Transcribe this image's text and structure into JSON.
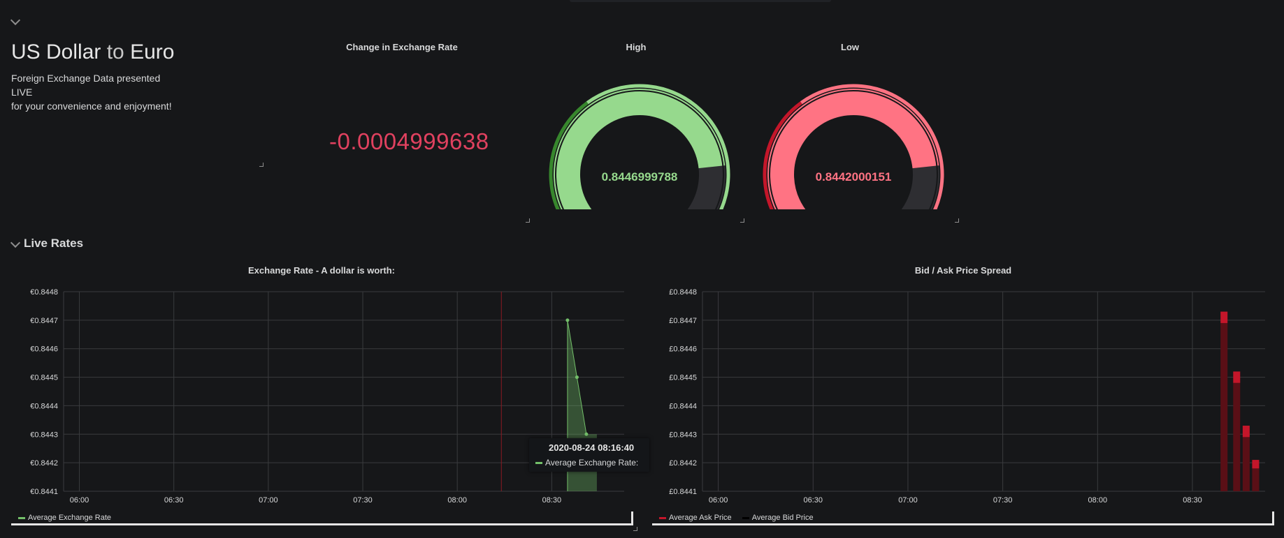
{
  "header": {
    "title_from": "US Dollar",
    "title_to_word": "to",
    "title_to": "Euro",
    "desc_line1": "Foreign Exchange Data presented LIVE",
    "desc_line2": "for your convenience and enjoyment!"
  },
  "stat_panel": {
    "title": "Change in Exchange Rate",
    "value": "-0.0004999638",
    "color": "#e0415f"
  },
  "gauge_high": {
    "title": "High",
    "value": "0.8446999788",
    "fill_fraction": 0.78,
    "color": "#96d98d",
    "dark_color": "#37872d",
    "text_color": "#96d98d"
  },
  "gauge_low": {
    "title": "Low",
    "value": "0.8442000151",
    "fill_fraction": 0.78,
    "color": "#ff7383",
    "dark_color": "#c4162a",
    "text_color": "#ff7383"
  },
  "row": {
    "title": "Live Rates"
  },
  "chart_left": {
    "title": "Exchange Rate - A dollar is worth:",
    "legend": "Average Exchange Rate",
    "tooltip_time": "2020-08-24 08:16:40",
    "tooltip_label": "Average Exchange Rate:"
  },
  "chart_right": {
    "title": "Bid / Ask Price Spread",
    "legend_ask": "Average Ask Price",
    "legend_bid": "Average Bid Price"
  },
  "chart_data": [
    {
      "type": "area",
      "title": "Exchange Rate - A dollar is worth:",
      "x_ticks": [
        "06:00",
        "06:30",
        "07:00",
        "07:30",
        "08:00",
        "08:30"
      ],
      "y_ticks": [
        "€0.8441",
        "€0.8442",
        "€0.8443",
        "€0.8444",
        "€0.8445",
        "€0.8446",
        "€0.8447",
        "€0.8448"
      ],
      "ylim": [
        0.8441,
        0.8448
      ],
      "xlim": [
        "05:55",
        "08:53"
      ],
      "series": [
        {
          "name": "Average Exchange Rate",
          "color": "#73bf69",
          "points": [
            {
              "x": "08:35",
              "y": 0.8447
            },
            {
              "x": "08:38",
              "y": 0.8445
            },
            {
              "x": "08:41",
              "y": 0.8443
            }
          ]
        }
      ],
      "annotation_x": "08:14"
    },
    {
      "type": "bar",
      "title": "Bid / Ask Price Spread",
      "x_ticks": [
        "06:00",
        "06:30",
        "07:00",
        "07:30",
        "08:00",
        "08:30"
      ],
      "y_ticks": [
        "£0.8448",
        "£0.8447",
        "£0.8446",
        "£0.8445",
        "£0.8444",
        "£0.8443",
        "£0.8442",
        "£0.8441"
      ],
      "ylim": [
        0.8441,
        0.8448
      ],
      "xlim": [
        "05:55",
        "08:53"
      ],
      "series": [
        {
          "name": "Average Ask Price",
          "color": "#c4162a",
          "points": [
            {
              "x": "08:40",
              "y": 0.84473
            },
            {
              "x": "08:44",
              "y": 0.84452
            },
            {
              "x": "08:47",
              "y": 0.84433
            },
            {
              "x": "08:50",
              "y": 0.84421
            }
          ]
        },
        {
          "name": "Average Bid Price",
          "color": "#000000",
          "points": [
            {
              "x": "08:40",
              "y": 0.84469
            },
            {
              "x": "08:44",
              "y": 0.84448
            },
            {
              "x": "08:47",
              "y": 0.84429
            },
            {
              "x": "08:50",
              "y": 0.84418
            }
          ]
        }
      ]
    }
  ]
}
